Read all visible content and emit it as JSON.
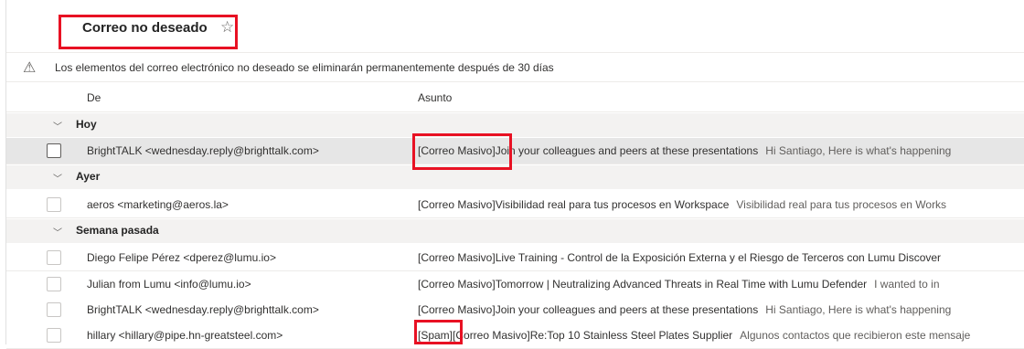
{
  "folder": {
    "title": "Correo no deseado",
    "star_icon": "star-outline-icon"
  },
  "info": {
    "icon": "warning-icon",
    "text": "Los elementos del correo electrónico no deseado se eliminarán permanentemente después de 30 días"
  },
  "columns": {
    "from": "De",
    "subject": "Asunto"
  },
  "groups": [
    {
      "label": "Hoy"
    },
    {
      "label": "Ayer"
    },
    {
      "label": "Semana pasada"
    }
  ],
  "messages": [
    {
      "from": "BrightTALK <wednesday.reply@brighttalk.com>",
      "subject": "[Correo Masivo]Join your colleagues and peers at these presentations",
      "preview": "Hi Santiago, Here is what's happening",
      "selected": true
    },
    {
      "from": "aeros <marketing@aeros.la>",
      "subject": "[Correo Masivo]Visibilidad real para tus procesos en Workspace",
      "preview": "Visibilidad real para tus procesos en Works",
      "selected": false
    },
    {
      "from": "Diego Felipe Pérez <dperez@lumu.io>",
      "subject": "[Correo Masivo]Live Training - Control de la Exposición Externa y el Riesgo de Terceros con Lumu Discover",
      "preview": "",
      "selected": false
    },
    {
      "from": "Julian from Lumu <info@lumu.io>",
      "subject": "[Correo Masivo]Tomorrow  | Neutralizing Advanced Threats in Real Time with Lumu Defender",
      "preview": "I wanted to in",
      "selected": false
    },
    {
      "from": "BrightTALK <wednesday.reply@brighttalk.com>",
      "subject": "[Correo Masivo]Join your colleagues and peers at these presentations",
      "preview": "Hi Santiago, Here is what's happening",
      "selected": false
    },
    {
      "from": "hillary <hillary@pipe.hn-greatsteel.com>",
      "subject": "[Spam][Correo Masivo]Re:Top 10 Stainless Steel Plates Supplier",
      "preview": "Algunos contactos que recibieron este mensaje",
      "selected": false
    }
  ],
  "colors": {
    "highlight": "#e81123",
    "selected_row": "#e6e6e6",
    "group_bg": "#f3f2f1"
  }
}
